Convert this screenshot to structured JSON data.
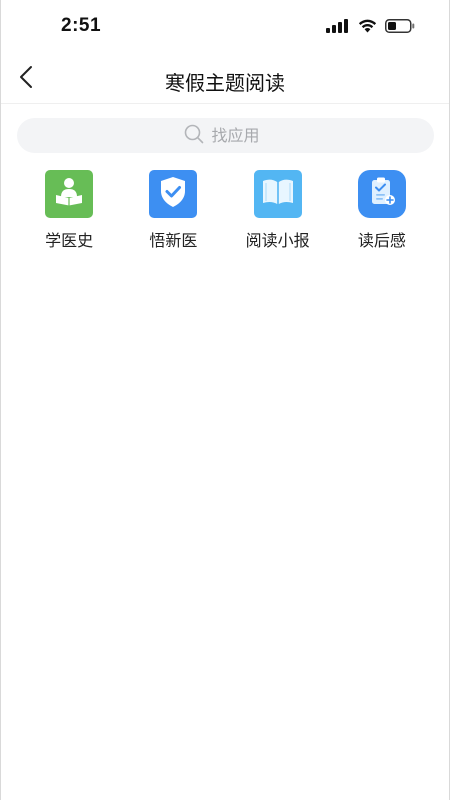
{
  "status_bar": {
    "time": "2:51",
    "icons": [
      "cellular-signal-icon",
      "wifi-icon",
      "battery-icon"
    ]
  },
  "nav": {
    "title": "寒假主题阅读",
    "back_icon": "chevron-left-icon"
  },
  "search": {
    "placeholder": "找应用",
    "value": "",
    "icon": "search-icon"
  },
  "apps": [
    {
      "label": "学医史",
      "icon": "reading-person-icon",
      "color": "#67bd56"
    },
    {
      "label": "悟新医",
      "icon": "shield-check-icon",
      "color": "#3d8ff2"
    },
    {
      "label": "阅读小报",
      "icon": "open-book-icon",
      "color": "#53b6f3"
    },
    {
      "label": "读后感",
      "icon": "clipboard-check-icon",
      "color": "#3d8ff2"
    }
  ],
  "colors": {
    "background": "#ffffff",
    "search_background": "#f3f4f6",
    "placeholder": "#a7a9ad"
  }
}
